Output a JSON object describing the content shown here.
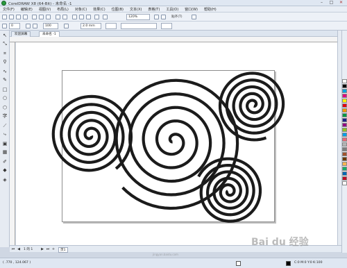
{
  "window": {
    "title": "CorelDRAW X8 (64-Bit) - 未命名 -1"
  },
  "menu": [
    "文件(F)",
    "编辑(E)",
    "视图(V)",
    "布局(L)",
    "对象(C)",
    "效果(C)",
    "位图(B)",
    "文本(X)",
    "表格(T)",
    "工具(O)",
    "窗口(W)",
    "帮助(H)"
  ],
  "toolbar": {
    "zoom": "120%",
    "snap_label": "贴齐(T)"
  },
  "property_bar": {
    "x_field": "0",
    "rotate_field": "100",
    "outline_width": "2.0 mm"
  },
  "tabs": [
    "欢迎屏幕",
    "未命名 -1"
  ],
  "pagebar": {
    "counter": "1 的 1",
    "page_tab": "页1"
  },
  "status": {
    "coords": "( .770 , 124.067 )",
    "fill_info": "C:0 M:0 Y:0 K:100"
  },
  "watermark": {
    "logo": "Bai du 经验",
    "sub": "jingyan.baidu.com"
  },
  "colors": {
    "accent": "#1b1b1b",
    "canvas": "#ffffff"
  },
  "icons": [
    "pick-tool-icon",
    "shape-tool-icon",
    "crop-tool-icon",
    "zoom-tool-icon",
    "freehand-tool-icon",
    "artistic-media-icon",
    "rectangle-tool-icon",
    "ellipse-tool-icon",
    "polygon-tool-icon",
    "text-tool-icon",
    "parallel-dimension-icon",
    "connector-tool-icon",
    "drop-shadow-icon",
    "transparency-icon",
    "eyedropper-icon",
    "interactive-fill-icon",
    "smart-fill-icon"
  ]
}
